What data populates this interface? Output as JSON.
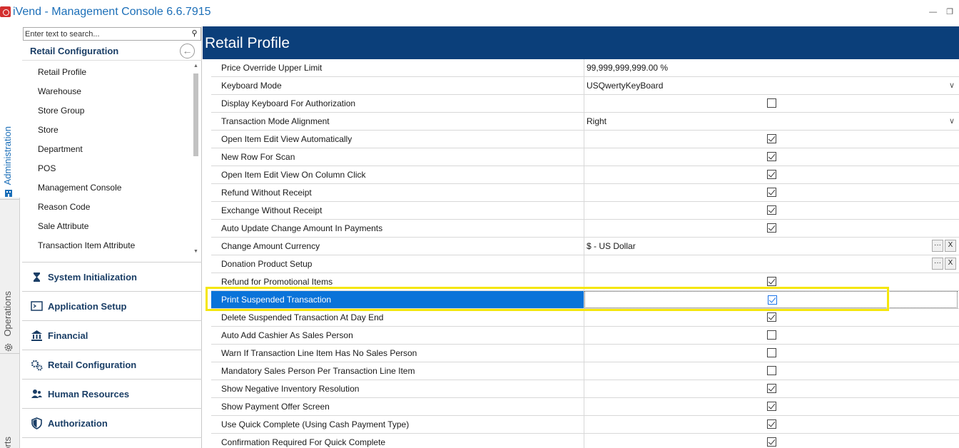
{
  "window": {
    "title": "iVend - Management Console  6.6.7915"
  },
  "rail": {
    "tabs": [
      {
        "label": "Administration"
      },
      {
        "label": "Operations"
      },
      {
        "label": "orts"
      }
    ]
  },
  "nav": {
    "search_placeholder": "Enter text to search...",
    "section_title": "Retail Configuration",
    "sub_items": [
      "Retail Profile",
      "Warehouse",
      "Store Group",
      "Store",
      "Department",
      "POS",
      "Management Console",
      "Reason Code",
      "Sale Attribute",
      "Transaction Item Attribute"
    ],
    "modules": [
      {
        "label": "System Initialization",
        "icon": "hourglass-icon"
      },
      {
        "label": "Application Setup",
        "icon": "terminal-icon"
      },
      {
        "label": "Financial",
        "icon": "bank-icon"
      },
      {
        "label": "Retail Configuration",
        "icon": "gears-icon"
      },
      {
        "label": "Human Resources",
        "icon": "people-icon"
      },
      {
        "label": "Authorization",
        "icon": "shield-icon"
      }
    ]
  },
  "main": {
    "title": "Retail Profile",
    "rows": [
      {
        "label": "Price Override Upper Limit",
        "type": "text",
        "value": "99,999,999,999.00 %"
      },
      {
        "label": "Keyboard Mode",
        "type": "dropdown",
        "value": "USQwertyKeyBoard"
      },
      {
        "label": "Display Keyboard For Authorization",
        "type": "checkbox",
        "checked": false
      },
      {
        "label": "Transaction Mode Alignment",
        "type": "dropdown",
        "value": "Right"
      },
      {
        "label": "Open Item Edit View Automatically",
        "type": "checkbox",
        "checked": true
      },
      {
        "label": "New Row For Scan",
        "type": "checkbox",
        "checked": true
      },
      {
        "label": "Open Item Edit View On Column Click",
        "type": "checkbox",
        "checked": true
      },
      {
        "label": "Refund Without Receipt",
        "type": "checkbox",
        "checked": true
      },
      {
        "label": "Exchange Without Receipt",
        "type": "checkbox",
        "checked": true
      },
      {
        "label": "Auto Update Change Amount In Payments",
        "type": "checkbox",
        "checked": true
      },
      {
        "label": "Change Amount Currency",
        "type": "lookup",
        "value": "$ - US Dollar"
      },
      {
        "label": "Donation Product Setup",
        "type": "lookup",
        "value": ""
      },
      {
        "label": "Refund for Promotional Items",
        "type": "checkbox",
        "checked": true
      },
      {
        "label": "Print Suspended Transaction",
        "type": "checkbox",
        "checked": true,
        "selected": true
      },
      {
        "label": "Delete Suspended Transaction At Day End",
        "type": "checkbox",
        "checked": true
      },
      {
        "label": "Auto Add Cashier As Sales Person",
        "type": "checkbox",
        "checked": false
      },
      {
        "label": "Warn If Transaction Line Item Has No Sales Person",
        "type": "checkbox",
        "checked": false
      },
      {
        "label": "Mandatory Sales Person Per Transaction Line Item",
        "type": "checkbox",
        "checked": false
      },
      {
        "label": "Show Negative Inventory Resolution",
        "type": "checkbox",
        "checked": true
      },
      {
        "label": "Show Payment Offer Screen",
        "type": "checkbox",
        "checked": true
      },
      {
        "label": "Use Quick Complete (Using Cash Payment Type)",
        "type": "checkbox",
        "checked": true
      },
      {
        "label": "Confirmation Required For Quick Complete",
        "type": "checkbox",
        "checked": true
      }
    ],
    "lookup_buttons": {
      "browse": "···",
      "clear": "X"
    }
  },
  "colors": {
    "header_bg": "#0b3f7a",
    "selection": "#0a73d9",
    "highlight_box": "#f5e60a",
    "title_blue": "#1c6fb8"
  }
}
